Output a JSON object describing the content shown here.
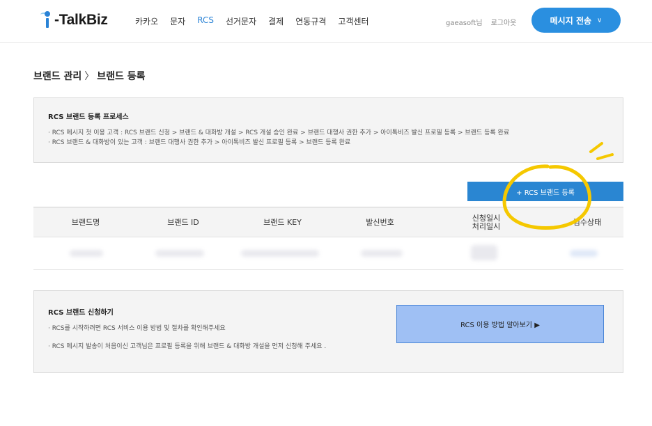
{
  "header": {
    "logo_text": "-TalkBiz",
    "nav": [
      "카카오",
      "문자",
      "RCS",
      "선거문자",
      "결제",
      "연동규격",
      "고객센터"
    ],
    "active_nav": "RCS",
    "user_name": "gaeasoft님",
    "logout_label": "로그아웃",
    "send_label": "메시지 전송"
  },
  "breadcrumb": {
    "parent": "브랜드 관리",
    "separator": "〉",
    "current": "브랜드 등록"
  },
  "process": {
    "title": "RCS 브랜드 등록 프로세스",
    "lines": [
      "· RCS 메시지 첫 이용 고객 : RCS 브랜드 신청 > 브랜드 & 대화방 개설 > RCS 개설 승인 완료 > 브랜드 대행사 권한 추가 > 아이톡비즈 발신 프로필 등록 > 브랜드 등록 완료",
      "· RCS 브랜드 & 대화방이 있는 고객 : 브랜드 대행사 권한 추가 > 아이톡비즈 발신 프로필 등록 > 브랜드 등록 완료"
    ]
  },
  "register_button": "+ RCS 브랜드 등록",
  "table": {
    "columns": [
      "브랜드명",
      "브랜드 ID",
      "브랜드 KEY",
      "발신번호",
      "신청일시",
      "처리일시",
      "검수상태"
    ]
  },
  "apply": {
    "title": "RCS 브랜드 신청하기",
    "lines": [
      "· RCS를 시작하려면 RCS 서비스 이용 방법 및 절차를 확인해주세요",
      "· RCS 메시지 발송이 처음이신 고객님은 프로필 등록을 위해 브랜드 & 대화방 개설을 먼저 신청해 주세요 ."
    ],
    "howto_button": "RCS 이용 방법 알아보기 ▶"
  },
  "colors": {
    "accent": "#2a8fe0",
    "annotation": "#f5c800"
  }
}
